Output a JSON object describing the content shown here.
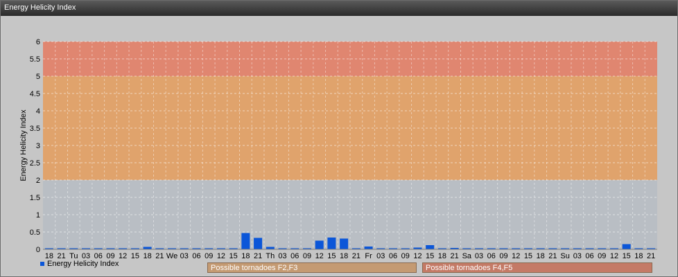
{
  "window": {
    "title": "Energy Helicity Index"
  },
  "legend": {
    "series_label": "Energy Helicity Index"
  },
  "risk_labels": [
    {
      "label": "Possible tornadoes F2,F3",
      "color": "#c49a72"
    },
    {
      "label": "Possible tornadoes F4,F5",
      "color": "#c47a66"
    }
  ],
  "colors": {
    "bar": "#0b56d8",
    "zone_low": "#b9bec4",
    "zone_mid": "#e0a36c",
    "zone_high": "#e08670"
  },
  "chart_data": {
    "type": "bar",
    "ylabel": "Energy Helicity Index",
    "ylim": [
      0,
      6
    ],
    "yticks": [
      "0",
      "0.5",
      "1",
      "1.5",
      "2",
      "2.5",
      "3",
      "3.5",
      "4",
      "4.5",
      "5",
      "5.5",
      "6"
    ],
    "grid": true,
    "zones": [
      {
        "from": 0,
        "to": 2,
        "color": "#b9bec4"
      },
      {
        "from": 2,
        "to": 5,
        "color": "#e0a36c"
      },
      {
        "from": 5,
        "to": 6,
        "color": "#e08670"
      }
    ],
    "categories": [
      "18",
      "21",
      "Tu",
      "03",
      "06",
      "09",
      "12",
      "15",
      "18",
      "21",
      "We",
      "03",
      "06",
      "09",
      "12",
      "15",
      "18",
      "21",
      "Th",
      "03",
      "06",
      "09",
      "12",
      "15",
      "18",
      "21",
      "Fr",
      "03",
      "06",
      "09",
      "12",
      "15",
      "18",
      "21",
      "Sa",
      "03",
      "06",
      "09",
      "12",
      "15",
      "18",
      "21",
      "Su",
      "03",
      "06",
      "09",
      "12",
      "15",
      "18",
      "21"
    ],
    "series": [
      {
        "values": [
          0.02,
          0.02,
          0.02,
          0.02,
          0.02,
          0.02,
          0.02,
          0.02,
          0.07,
          0.02,
          0.03,
          0.02,
          0.02,
          0.02,
          0.02,
          0.02,
          0.47,
          0.33,
          0.07,
          0.02,
          0.02,
          0.02,
          0.25,
          0.34,
          0.31,
          0.02,
          0.08,
          0.02,
          0.02,
          0.02,
          0.05,
          0.12,
          0.03,
          0.04,
          0.02,
          0.02,
          0.03,
          0.02,
          0.02,
          0.02,
          0.02,
          0.02,
          0.03,
          0.02,
          0.02,
          0.02,
          0.02,
          0.15,
          0.02,
          0.02
        ]
      }
    ]
  }
}
